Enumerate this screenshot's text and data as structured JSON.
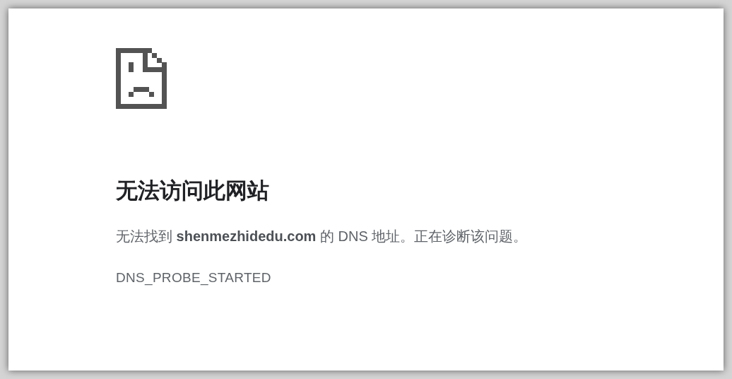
{
  "heading": "无法访问此网站",
  "message": "无法找到 **shenmezhidedu.com** 的 DNS 地址。正在诊断该问题。",
  "error_code": "DNS_PROBE_STARTED"
}
